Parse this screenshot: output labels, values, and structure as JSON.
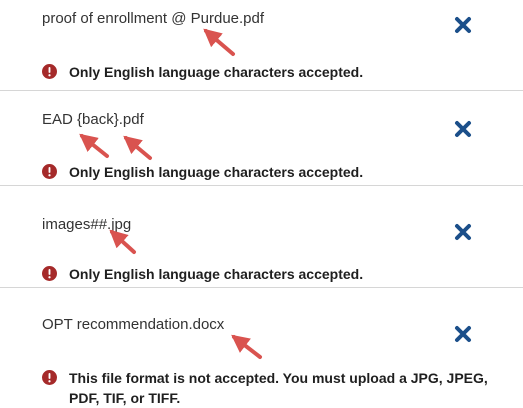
{
  "files": [
    {
      "name": "proof of enrollment @ Purdue.pdf",
      "remove_icon": "close-icon",
      "error_icon": "exclamation-circle-icon",
      "error": "Only English language characters accepted."
    },
    {
      "name": "EAD {back}.pdf",
      "remove_icon": "close-icon",
      "error_icon": "exclamation-circle-icon",
      "error": "Only English language characters accepted."
    },
    {
      "name": "images##.jpg",
      "remove_icon": "close-icon",
      "error_icon": "exclamation-circle-icon",
      "error": "Only English language characters accepted."
    },
    {
      "name": "OPT recommendation.docx",
      "remove_icon": "close-icon",
      "error_icon": "exclamation-circle-icon",
      "error": "This file format is not accepted. You must upload a JPG, JPEG, PDF, TIF, or TIFF."
    }
  ],
  "colors": {
    "remove_icon": "#1b4f8a",
    "error_icon": "#a52a2a",
    "annotation_arrow": "#d9534f",
    "divider": "#d6d6d6"
  }
}
